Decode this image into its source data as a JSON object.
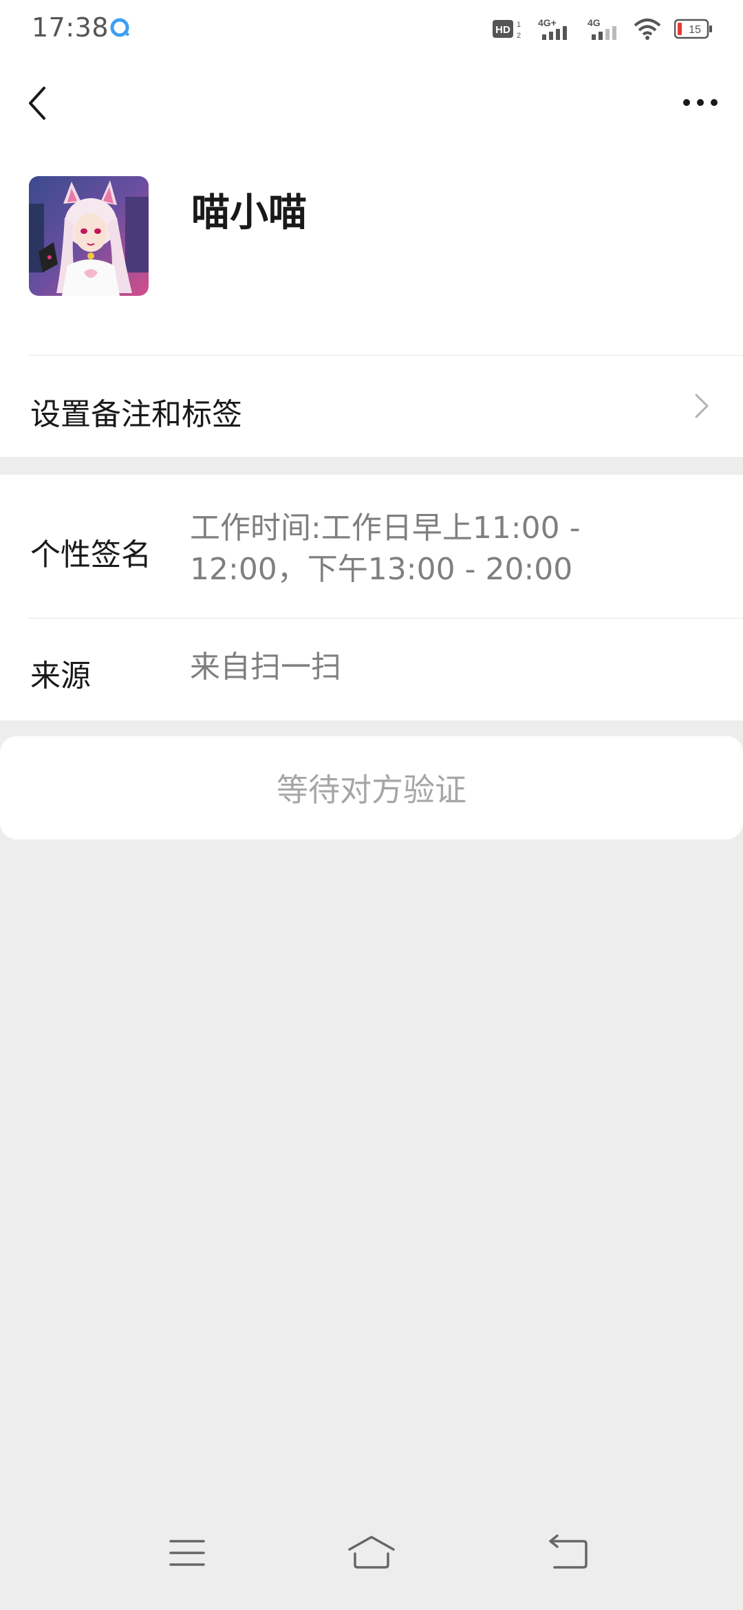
{
  "status_bar": {
    "time": "17:38",
    "battery": "15",
    "network_1": "4G+",
    "network_2": "4G",
    "hd_badge": "HD"
  },
  "nav": {
    "back_icon": "chevron-left-icon",
    "more_icon": "more-dots-icon"
  },
  "profile": {
    "nickname": "喵小喵",
    "avatar": "anime-catgirl-avatar"
  },
  "remark_row": {
    "label": "设置备注和标签"
  },
  "info": {
    "signature_label": "个性签名",
    "signature_value": "工作时间:工作日早上11:00 - 12:00，下午13:00 - 20:00",
    "source_label": "来源",
    "source_value": "来自扫一扫"
  },
  "action": {
    "wait_label": "等待对方验证"
  },
  "colors": {
    "background": "#ededed",
    "card": "#ffffff",
    "primary_text": "#191919",
    "secondary_text": "#7f7f7f",
    "disabled_text": "#a6a6a6"
  }
}
